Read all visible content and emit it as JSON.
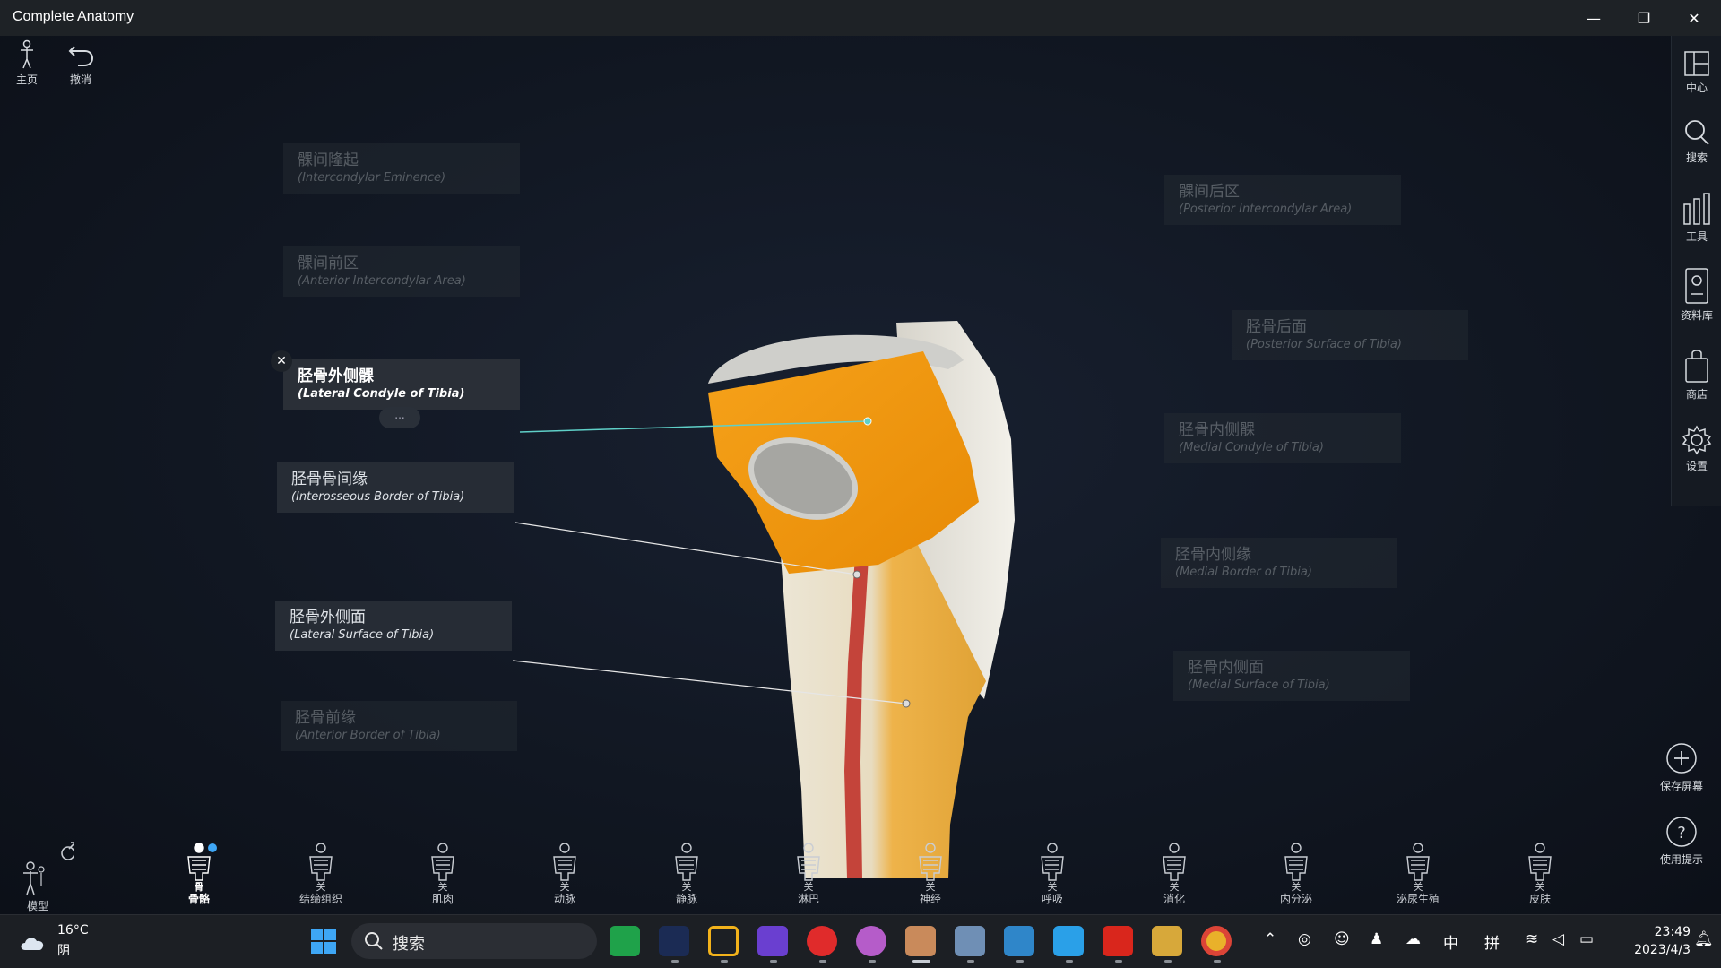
{
  "window": {
    "title": "Complete Anatomy",
    "minimize": "—",
    "restore": "❐",
    "close": "✕"
  },
  "top_tools": {
    "home_label": "主页",
    "undo_label": "撤消"
  },
  "right_sidebar": [
    {
      "icon": "layout-icon",
      "label": "中心"
    },
    {
      "icon": "search-icon",
      "label": "搜索"
    },
    {
      "icon": "tools-icon",
      "label": "工具"
    },
    {
      "icon": "library-icon",
      "label": "资料库"
    },
    {
      "icon": "shop-icon",
      "label": "商店"
    },
    {
      "icon": "gear-icon",
      "label": "设置"
    }
  ],
  "right_float": {
    "save_screen_label": "保存屏幕",
    "tips_label": "使用提示"
  },
  "labels": {
    "intercondylar_eminence": {
      "cn": "髁间隆起",
      "en": "(Intercondylar Eminence)"
    },
    "anterior_intercondylar": {
      "cn": "髁间前区",
      "en": "(Anterior Intercondylar Area)"
    },
    "lateral_condyle": {
      "cn": "胫骨外侧髁",
      "en": "(Lateral Condyle of Tibia)"
    },
    "interosseous_border": {
      "cn": "胫骨骨间缘",
      "en": "(Interosseous Border of Tibia)"
    },
    "lateral_surface": {
      "cn": "胫骨外侧面",
      "en": "(Lateral Surface of Tibia)"
    },
    "anterior_border": {
      "cn": "胫骨前缘",
      "en": "(Anterior Border of Tibia)"
    },
    "posterior_intercondylar": {
      "cn": "髁间后区",
      "en": "(Posterior Intercondylar Area)"
    },
    "posterior_surface": {
      "cn": "胫骨后面",
      "en": "(Posterior Surface of Tibia)"
    },
    "medial_condyle": {
      "cn": "胫骨内侧髁",
      "en": "(Medial Condyle of Tibia)"
    },
    "medial_border": {
      "cn": "胫骨内侧缘",
      "en": "(Medial Border of Tibia)"
    },
    "medial_surface": {
      "cn": "胫骨内侧面",
      "en": "(Medial Surface of Tibia)"
    }
  },
  "label_controls": {
    "close": "✕",
    "more": "..."
  },
  "systems": {
    "model": "模型",
    "items": [
      {
        "top": "",
        "label": "骨骼",
        "active": true
      },
      {
        "top": "关",
        "label": "结缔组织"
      },
      {
        "top": "关",
        "label": "肌肉"
      },
      {
        "top": "关",
        "label": "动脉"
      },
      {
        "top": "关",
        "label": "静脉"
      },
      {
        "top": "关",
        "label": "淋巴"
      },
      {
        "top": "关",
        "label": "神经"
      },
      {
        "top": "关",
        "label": "呼吸"
      },
      {
        "top": "关",
        "label": "消化"
      },
      {
        "top": "关",
        "label": "内分泌"
      },
      {
        "top": "关",
        "label": "泌尿生殖"
      },
      {
        "top": "关",
        "label": "皮肤"
      }
    ],
    "skeleton_top": "骨"
  },
  "taskbar": {
    "weather_temp": "16°C",
    "weather_desc": "阴",
    "search_placeholder": "搜索",
    "ime_lang": "中",
    "ime_mode": "拼",
    "time": "23:49",
    "date": "2023/4/3"
  },
  "colors": {
    "bone_highlight": "#f39a0c",
    "bone_shaft": "#e9ad3c",
    "leader_active": "#5fd0c8"
  }
}
